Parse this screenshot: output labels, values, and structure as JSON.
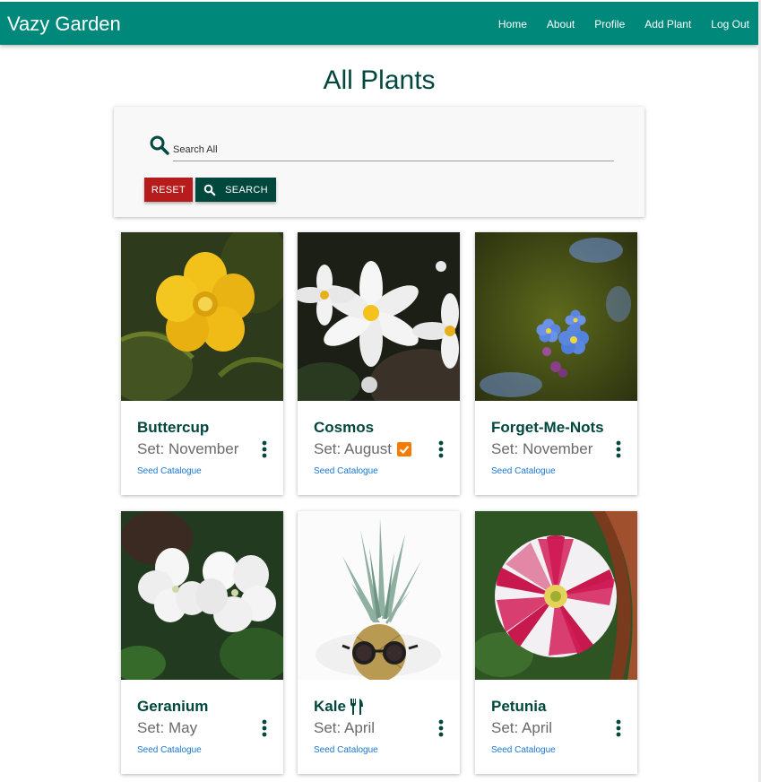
{
  "app": {
    "brand": "Vazy Garden"
  },
  "nav": {
    "items": [
      {
        "label": "Home"
      },
      {
        "label": "About"
      },
      {
        "label": "Profile"
      },
      {
        "label": "Add Plant"
      },
      {
        "label": "Log Out"
      }
    ]
  },
  "page": {
    "title": "All Plants"
  },
  "search": {
    "placeholder": "Search All",
    "value": "",
    "reset_label": "RESET",
    "search_label": "SEARCH"
  },
  "colors": {
    "navbar": "#00897b",
    "primary_dark": "#00473e",
    "reset": "#b71c1c",
    "link": "#1976d2",
    "badge": "#f57c00"
  },
  "plants": [
    {
      "name": "Buttercup",
      "set": "Set: November",
      "link": "Seed Catalogue",
      "image": "yellow-buttercup-flower",
      "badge": null
    },
    {
      "name": "Cosmos",
      "set": "Set: August",
      "link": "Seed Catalogue",
      "image": "white-cosmos-flowers",
      "badge": "checkbox-icon"
    },
    {
      "name": "Forget-Me-Nots",
      "set": "Set: November",
      "link": "Seed Catalogue",
      "image": "blue-forget-me-not-flowers",
      "badge": null
    },
    {
      "name": "Geranium",
      "set": "Set: May",
      "link": "Seed Catalogue",
      "image": "white-geranium-flowers",
      "badge": null
    },
    {
      "name": "Kale",
      "set": "Set: April",
      "link": "Seed Catalogue",
      "image": "pineapple-with-sunglasses",
      "badge": "utensils-icon"
    },
    {
      "name": "Petunia",
      "set": "Set: April",
      "link": "Seed Catalogue",
      "image": "pink-white-petunia-flower",
      "badge": null
    }
  ]
}
